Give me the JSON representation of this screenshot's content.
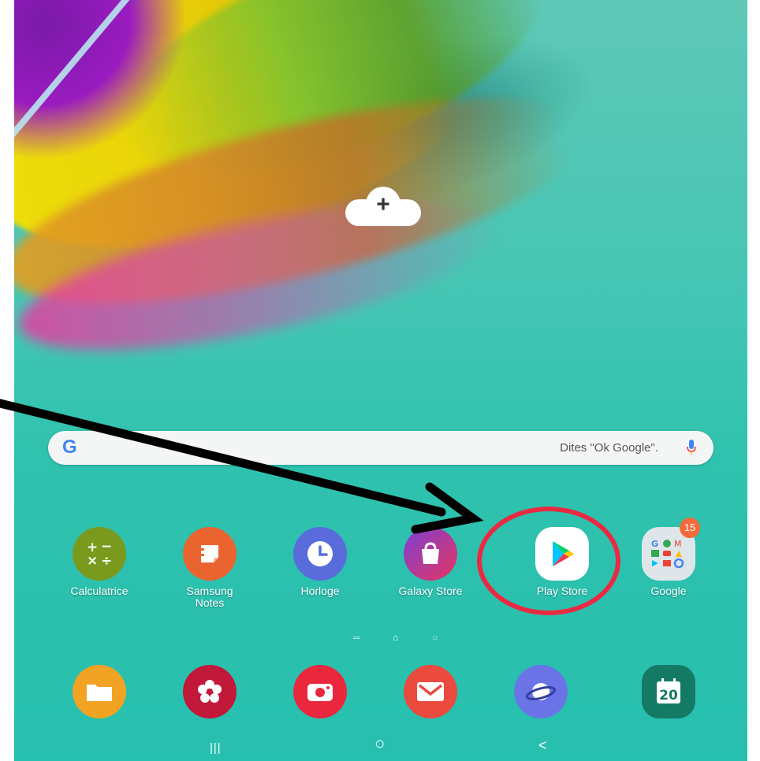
{
  "search": {
    "logo": "G",
    "hint": "Dites \"Ok Google\".",
    "mic_icon": "mic-icon"
  },
  "add_widget": {
    "label": "+"
  },
  "apps_row": [
    {
      "label": "Calculatrice",
      "icon": "calculator-icon"
    },
    {
      "label": "Samsung\nNotes",
      "icon": "notes-icon"
    },
    {
      "label": "Horloge",
      "icon": "clock-icon"
    },
    {
      "label": "Galaxy Store",
      "icon": "shopping-bag-icon"
    },
    {
      "label": "Play Store",
      "icon": "play-store-icon"
    },
    {
      "label": "Google",
      "icon": "google-folder-icon",
      "badge": "15"
    }
  ],
  "dock": [
    {
      "icon": "folder-icon"
    },
    {
      "icon": "flower-icon"
    },
    {
      "icon": "camera-icon"
    },
    {
      "icon": "mail-icon"
    },
    {
      "icon": "planet-icon"
    },
    {
      "icon": "calendar-icon",
      "text": "20"
    }
  ],
  "nav": {
    "recents": "|||",
    "home": "○",
    "back": "<"
  },
  "colors": {
    "highlight": "#ea2a43",
    "arrow": "#000000",
    "wallpaper": "#2fc2ae"
  }
}
